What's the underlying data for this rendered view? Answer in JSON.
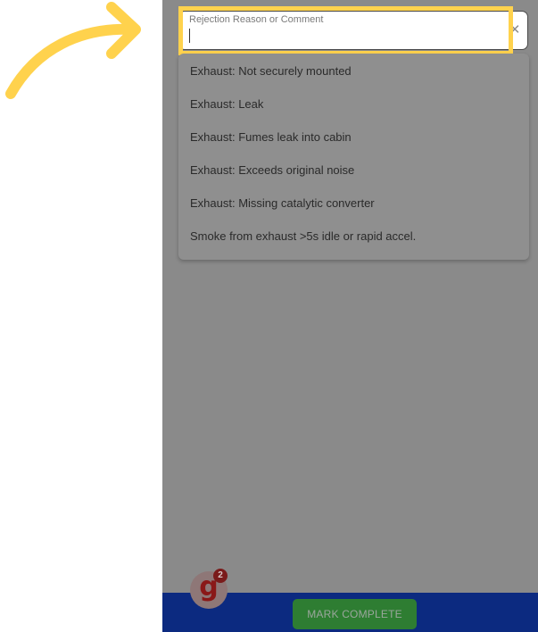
{
  "rejection_input": {
    "label": "Rejection Reason or Comment",
    "value": "",
    "clear_icon": "close-icon"
  },
  "options": [
    "Exhaust: Not securely mounted",
    "Exhaust: Leak",
    "Exhaust: Fumes leak into cabin",
    "Exhaust: Exceeds original noise",
    "Exhaust: Missing catalytic converter",
    "Smoke from exhaust >5s idle or rapid accel."
  ],
  "bottom_bar": {
    "mark_complete_label": "MARK COMPLETE"
  },
  "badge": {
    "letter": "g",
    "count": "2"
  },
  "colors": {
    "overlay": "#8a8a8a",
    "highlight": "#ffd24d",
    "bottom_bar": "#0c2a80",
    "button": "#2e7d32"
  }
}
